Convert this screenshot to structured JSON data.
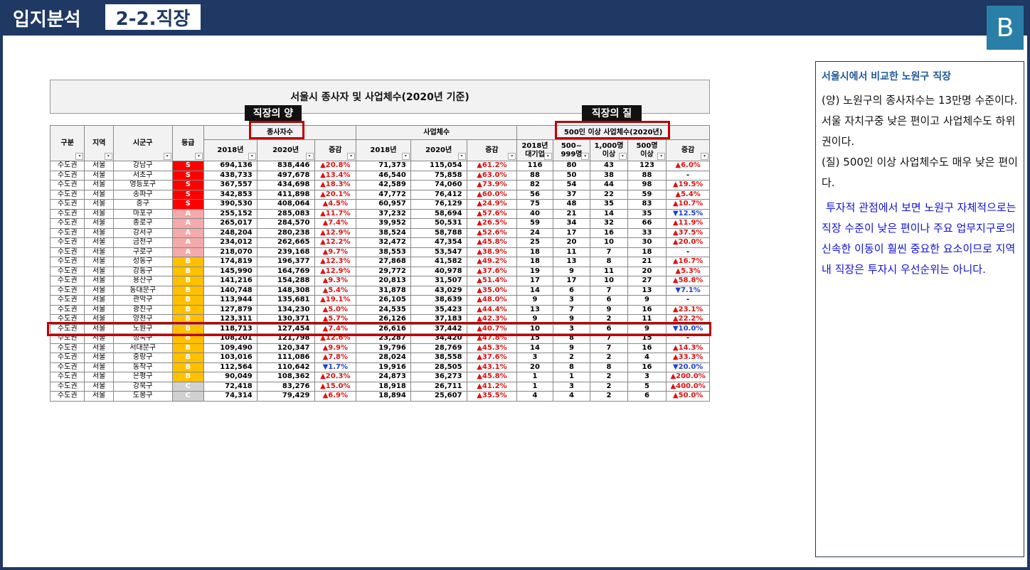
{
  "header": {
    "section": "입지분석",
    "subsection": "2-2.직장",
    "badge": "B"
  },
  "table_title": "서울시 종사자 및 사업체수(2020년 기준)",
  "tags": {
    "quantity": "직장의 양",
    "quality": "직장의 질"
  },
  "columns": {
    "category": "구분",
    "region": "지역",
    "district": "시군구",
    "grade": "등급",
    "workers_group": "종사자수",
    "business_group": "사업체수",
    "large_group": "500인 이상 사업체수(2020년)",
    "y2018": "2018년",
    "y2020": "2020년",
    "change": "증감",
    "big2018_line1": "2018년",
    "big2018_line2": "대기업",
    "c500_line1": "500~",
    "c500_line2": "999명",
    "c1000_line1": "1,000명",
    "c1000_line2": "이상",
    "c500plus_line1": "500명",
    "c500plus_line2": "이상"
  },
  "rows": [
    {
      "cat": "수도권",
      "reg": "서울",
      "dist": "강남구",
      "grade": "S",
      "w18": "694,136",
      "w20": "838,446",
      "wc": "▲20.8%",
      "b18": "71,373",
      "b20": "115,054",
      "bc": "▲61.2%",
      "big": "116",
      "c500": "80",
      "c1000": "43",
      "c500p": "123",
      "lc": "▲6.0%"
    },
    {
      "cat": "수도권",
      "reg": "서울",
      "dist": "서초구",
      "grade": "S",
      "w18": "438,733",
      "w20": "497,678",
      "wc": "▲13.4%",
      "b18": "46,540",
      "b20": "75,858",
      "bc": "▲63.0%",
      "big": "88",
      "c500": "50",
      "c1000": "38",
      "c500p": "88",
      "lc": "-"
    },
    {
      "cat": "수도권",
      "reg": "서울",
      "dist": "영등포구",
      "grade": "S",
      "w18": "367,557",
      "w20": "434,698",
      "wc": "▲18.3%",
      "b18": "42,589",
      "b20": "74,060",
      "bc": "▲73.9%",
      "big": "82",
      "c500": "54",
      "c1000": "44",
      "c500p": "98",
      "lc": "▲19.5%"
    },
    {
      "cat": "수도권",
      "reg": "서울",
      "dist": "송파구",
      "grade": "S",
      "w18": "342,853",
      "w20": "411,898",
      "wc": "▲20.1%",
      "b18": "47,772",
      "b20": "76,412",
      "bc": "▲60.0%",
      "big": "56",
      "c500": "37",
      "c1000": "22",
      "c500p": "59",
      "lc": "▲5.4%"
    },
    {
      "cat": "수도권",
      "reg": "서울",
      "dist": "중구",
      "grade": "S",
      "w18": "390,530",
      "w20": "408,064",
      "wc": "▲4.5%",
      "b18": "60,957",
      "b20": "76,129",
      "bc": "▲24.9%",
      "big": "75",
      "c500": "48",
      "c1000": "35",
      "c500p": "83",
      "lc": "▲10.7%"
    },
    {
      "cat": "수도권",
      "reg": "서울",
      "dist": "마포구",
      "grade": "A",
      "w18": "255,152",
      "w20": "285,083",
      "wc": "▲11.7%",
      "b18": "37,232",
      "b20": "58,694",
      "bc": "▲57.6%",
      "big": "40",
      "c500": "21",
      "c1000": "14",
      "c500p": "35",
      "lc": "▼12.5%"
    },
    {
      "cat": "수도권",
      "reg": "서울",
      "dist": "종로구",
      "grade": "A",
      "w18": "265,017",
      "w20": "284,570",
      "wc": "▲7.4%",
      "b18": "39,952",
      "b20": "50,531",
      "bc": "▲26.5%",
      "big": "59",
      "c500": "34",
      "c1000": "32",
      "c500p": "66",
      "lc": "▲11.9%"
    },
    {
      "cat": "수도권",
      "reg": "서울",
      "dist": "강서구",
      "grade": "A",
      "w18": "248,204",
      "w20": "280,238",
      "wc": "▲12.9%",
      "b18": "38,524",
      "b20": "58,788",
      "bc": "▲52.6%",
      "big": "24",
      "c500": "17",
      "c1000": "16",
      "c500p": "33",
      "lc": "▲37.5%"
    },
    {
      "cat": "수도권",
      "reg": "서울",
      "dist": "금천구",
      "grade": "A",
      "w18": "234,012",
      "w20": "262,665",
      "wc": "▲12.2%",
      "b18": "32,472",
      "b20": "47,354",
      "bc": "▲45.8%",
      "big": "25",
      "c500": "20",
      "c1000": "10",
      "c500p": "30",
      "lc": "▲20.0%"
    },
    {
      "cat": "수도권",
      "reg": "서울",
      "dist": "구로구",
      "grade": "A",
      "w18": "218,070",
      "w20": "239,168",
      "wc": "▲9.7%",
      "b18": "38,553",
      "b20": "53,547",
      "bc": "▲38.9%",
      "big": "18",
      "c500": "11",
      "c1000": "7",
      "c500p": "18",
      "lc": "-"
    },
    {
      "cat": "수도권",
      "reg": "서울",
      "dist": "성동구",
      "grade": "B",
      "w18": "174,819",
      "w20": "196,377",
      "wc": "▲12.3%",
      "b18": "27,868",
      "b20": "41,582",
      "bc": "▲49.2%",
      "big": "18",
      "c500": "13",
      "c1000": "8",
      "c500p": "21",
      "lc": "▲16.7%"
    },
    {
      "cat": "수도권",
      "reg": "서울",
      "dist": "강동구",
      "grade": "B",
      "w18": "145,990",
      "w20": "164,769",
      "wc": "▲12.9%",
      "b18": "29,772",
      "b20": "40,978",
      "bc": "▲37.6%",
      "big": "19",
      "c500": "9",
      "c1000": "11",
      "c500p": "20",
      "lc": "▲5.3%"
    },
    {
      "cat": "수도권",
      "reg": "서울",
      "dist": "용산구",
      "grade": "B",
      "w18": "141,216",
      "w20": "154,288",
      "wc": "▲9.3%",
      "b18": "20,813",
      "b20": "31,507",
      "bc": "▲51.4%",
      "big": "17",
      "c500": "17",
      "c1000": "10",
      "c500p": "27",
      "lc": "▲58.8%"
    },
    {
      "cat": "수도권",
      "reg": "서울",
      "dist": "동대문구",
      "grade": "B",
      "w18": "140,748",
      "w20": "148,308",
      "wc": "▲5.4%",
      "b18": "31,878",
      "b20": "43,029",
      "bc": "▲35.0%",
      "big": "14",
      "c500": "6",
      "c1000": "7",
      "c500p": "13",
      "lc": "▼7.1%"
    },
    {
      "cat": "수도권",
      "reg": "서울",
      "dist": "관악구",
      "grade": "B",
      "w18": "113,944",
      "w20": "135,681",
      "wc": "▲19.1%",
      "b18": "26,105",
      "b20": "38,639",
      "bc": "▲48.0%",
      "big": "9",
      "c500": "3",
      "c1000": "6",
      "c500p": "9",
      "lc": "-"
    },
    {
      "cat": "수도권",
      "reg": "서울",
      "dist": "광진구",
      "grade": "B",
      "w18": "127,879",
      "w20": "134,230",
      "wc": "▲5.0%",
      "b18": "24,535",
      "b20": "35,423",
      "bc": "▲44.4%",
      "big": "13",
      "c500": "7",
      "c1000": "9",
      "c500p": "16",
      "lc": "▲23.1%"
    },
    {
      "cat": "수도권",
      "reg": "서울",
      "dist": "양천구",
      "grade": "B",
      "w18": "123,311",
      "w20": "130,371",
      "wc": "▲5.7%",
      "b18": "26,126",
      "b20": "37,183",
      "bc": "▲42.3%",
      "big": "9",
      "c500": "9",
      "c1000": "2",
      "c500p": "11",
      "lc": "▲22.2%"
    },
    {
      "cat": "수도권",
      "reg": "서울",
      "dist": "노원구",
      "grade": "B",
      "w18": "118,713",
      "w20": "127,454",
      "wc": "▲7.4%",
      "b18": "26,616",
      "b20": "37,442",
      "bc": "▲40.7%",
      "big": "10",
      "c500": "3",
      "c1000": "6",
      "c500p": "9",
      "lc": "▼10.0%"
    },
    {
      "cat": "수도권",
      "reg": "서울",
      "dist": "성북구",
      "grade": "B",
      "w18": "108,201",
      "w20": "121,798",
      "wc": "▲12.6%",
      "b18": "23,287",
      "b20": "34,420",
      "bc": "▲47.8%",
      "big": "15",
      "c500": "8",
      "c1000": "7",
      "c500p": "15",
      "lc": "-"
    },
    {
      "cat": "수도권",
      "reg": "서울",
      "dist": "서대문구",
      "grade": "B",
      "w18": "109,490",
      "w20": "120,347",
      "wc": "▲9.9%",
      "b18": "19,796",
      "b20": "28,769",
      "bc": "▲45.3%",
      "big": "14",
      "c500": "9",
      "c1000": "7",
      "c500p": "16",
      "lc": "▲14.3%"
    },
    {
      "cat": "수도권",
      "reg": "서울",
      "dist": "중랑구",
      "grade": "B",
      "w18": "103,016",
      "w20": "111,086",
      "wc": "▲7.8%",
      "b18": "28,024",
      "b20": "38,558",
      "bc": "▲37.6%",
      "big": "3",
      "c500": "2",
      "c1000": "2",
      "c500p": "4",
      "lc": "▲33.3%"
    },
    {
      "cat": "수도권",
      "reg": "서울",
      "dist": "동작구",
      "grade": "B",
      "w18": "112,564",
      "w20": "110,642",
      "wc": "▼1.7%",
      "b18": "19,916",
      "b20": "28,505",
      "bc": "▲43.1%",
      "big": "20",
      "c500": "8",
      "c1000": "8",
      "c500p": "16",
      "lc": "▼20.0%"
    },
    {
      "cat": "수도권",
      "reg": "서울",
      "dist": "은평구",
      "grade": "B",
      "w18": "90,049",
      "w20": "108,362",
      "wc": "▲20.3%",
      "b18": "24,873",
      "b20": "36,273",
      "bc": "▲45.8%",
      "big": "1",
      "c500": "1",
      "c1000": "2",
      "c500p": "3",
      "lc": "▲200.0%"
    },
    {
      "cat": "수도권",
      "reg": "서울",
      "dist": "강북구",
      "grade": "C",
      "w18": "72,418",
      "w20": "83,276",
      "wc": "▲15.0%",
      "b18": "18,918",
      "b20": "26,711",
      "bc": "▲41.2%",
      "big": "1",
      "c500": "3",
      "c1000": "2",
      "c500p": "5",
      "lc": "▲400.0%"
    },
    {
      "cat": "수도권",
      "reg": "서울",
      "dist": "도봉구",
      "grade": "C",
      "w18": "74,314",
      "w20": "79,429",
      "wc": "▲6.9%",
      "b18": "18,894",
      "b20": "25,607",
      "bc": "▲35.5%",
      "big": "4",
      "c500": "4",
      "c1000": "2",
      "c500p": "6",
      "lc": "▲50.0%"
    }
  ],
  "side": {
    "heading": "서울시에서 비교한 노원구 직장",
    "p1": "(양) 노원구의 종사자수는 13만명 수준이다. 서울 자치구중 낮은 편이고 사업체수도 하위권이다.",
    "p2": "(질) 500인 이상 사업체수도 매우 낮은 편이다.",
    "p3": "투자적 관점에서 보면 노원구 자체적으로는 직장 수준이 낮은 편이나 주요 업무지구로의 신속한 이동이 훨씬 중요한 요소이므로 지역내 직장은 투자시 우선순위는 아니다."
  },
  "colors": {
    "navy": "#1f3864",
    "badge": "#2a7fa8",
    "S": "#ff0000",
    "A": "#f4aaaa",
    "B": "#ffc000",
    "C": "#d0d0d0",
    "up": "#e01010",
    "down": "#1a3fd0",
    "highlight": "#c00000"
  }
}
